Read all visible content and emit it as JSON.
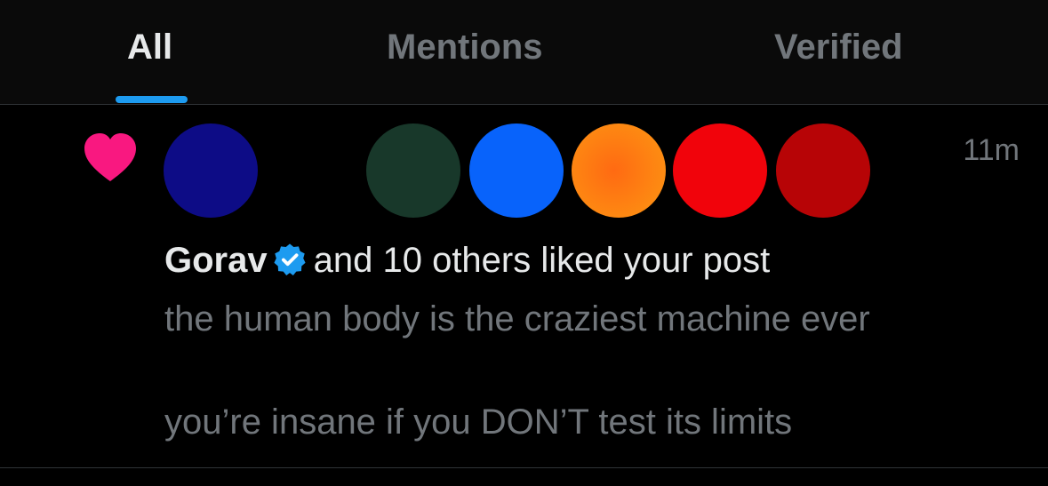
{
  "tabs": [
    {
      "label": "All",
      "active": true
    },
    {
      "label": "Mentions",
      "active": false
    },
    {
      "label": "Verified",
      "active": false
    }
  ],
  "colors": {
    "accent": "#1d9bf0",
    "like_heart": "#f91880",
    "avatars": [
      "#0d0c86",
      "#18382a",
      "#0863fb",
      "#fd7a0e",
      "#f1030b",
      "#b70406"
    ]
  },
  "icons": {
    "type": "heart-icon",
    "verified": "verified-badge-icon"
  },
  "notification": {
    "user_name": "Gorav",
    "action_text": "and 10 others liked your post",
    "time": "11m",
    "post_lines": [
      "the human body is the craziest machine ever",
      "",
      "you’re insane if you DON’T test its limits"
    ]
  }
}
